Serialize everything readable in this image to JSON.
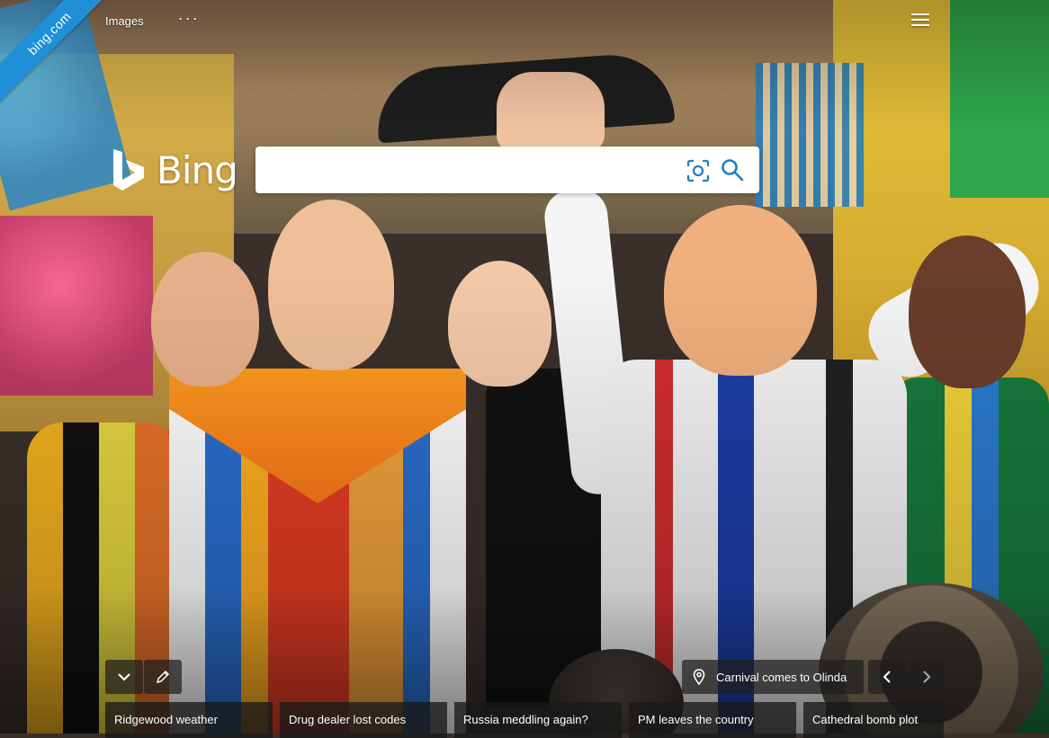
{
  "brand": {
    "ribbon_text": "bing.com",
    "logo_text": "Bing",
    "accent_color": "#1f8fd6"
  },
  "top_nav": {
    "images_label": "Images",
    "more_label": "···"
  },
  "search": {
    "value": "",
    "placeholder": "",
    "icon_visual": "visual-search-icon",
    "icon_search": "search-icon"
  },
  "image_info": {
    "caption": "Carnival comes to Olinda",
    "icon": "location-pin-icon"
  },
  "controls": {
    "collapse_icon": "chevron-down-icon",
    "edit_icon": "pencil-icon",
    "prev_icon": "chevron-left-icon",
    "next_icon": "chevron-right-icon",
    "menu_icon": "hamburger-menu-icon"
  },
  "trending": [
    {
      "label": "Ridgewood weather"
    },
    {
      "label": "Drug dealer lost codes"
    },
    {
      "label": "Russia meddling again?"
    },
    {
      "label": "PM leaves the country"
    },
    {
      "label": "Cathedral bomb plot"
    }
  ]
}
